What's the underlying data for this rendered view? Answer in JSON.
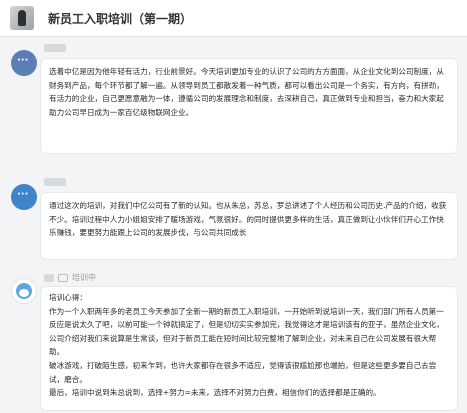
{
  "header": {
    "title": "新员工入职培训（第一期）"
  },
  "messages": [
    {
      "sender": "",
      "paragraphs": [
        "选着中亿是因为他年轻有活力，行业前景好。今天培训更加专业的认识了公司的方方面面，从企业文化到公司制度，从财务到产品，每个环节都了解一遍。从领导到员工都散发着一种气质，都可以看出公司是一个务实，有方向，有拼劲，有活力的企业，自己更愿意融为一体，遵循公司的发展理念和制度，去深耕自己，真正做到专业和担当，奋力和大家起助力公司早日成为一家百亿级物联网企业。"
      ]
    },
    {
      "sender": "",
      "paragraphs": [
        "通过这次的培训，对我们中亿公司有了新的认知。也从朱总，苏总，罗总讲述了个人经历和公司历史.产品的介绍，收获不少。培训过程中人力小姐姐安排了暖场游戏，气氛很好。的同时提供更多样的生活，真正做到让小伙伴们开心工作快乐赚钱，要更努力能跟上公司的发展步伐，与公司共同成长"
      ]
    },
    {
      "sender": "培训中",
      "paragraphs": [
        "培训心得：",
        "作为一个入职两年多的老员工今天参加了全新一期的新员工入职培训，一开始听到说培训一天，我们部门所有人员第一反应是说太久了吧，以前可能一个钟就搞定了，但是切切实实参加完，我觉得这才是培训该有的亚子，虽然企业文化，公司介绍对我们来说算是生常谈，但对于新员工能在短时间比较完整地了解到企业，对未来自己在公司发展有很大帮助。",
        "破冰游戏，打破陌生感，初来乍到，也许大家都存在很多不适应，觉得该很尴尬那也端拍，但是这些更多要自己去尝试，磨合。",
        "最后，培训中说到朱总说到，选择+努力=未来，选择不对努力白费，相信你们的选择都是正确的。"
      ]
    }
  ]
}
